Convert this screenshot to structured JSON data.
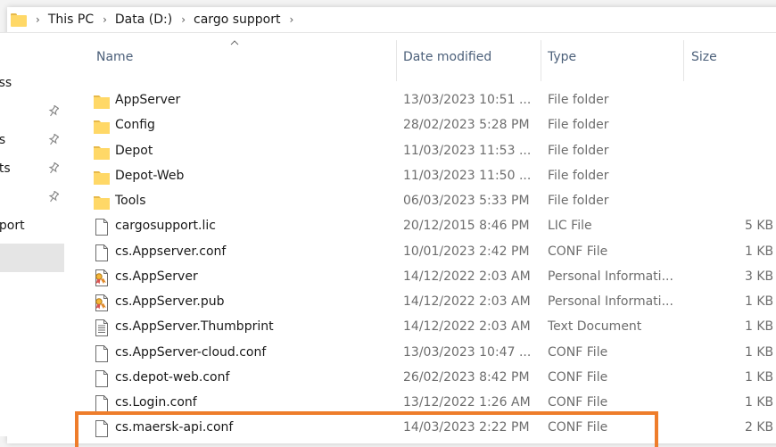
{
  "breadcrumb": [
    "This PC",
    "Data (D:)",
    "cargo support"
  ],
  "nav": {
    "items": [
      {
        "label": "ess",
        "pinned": false
      },
      {
        "label": "",
        "pinned": true
      },
      {
        "label": "ds",
        "pinned": true
      },
      {
        "label": "nts",
        "pinned": true
      },
      {
        "label": "",
        "pinned": true
      },
      {
        "label": "pport",
        "pinned": false
      }
    ]
  },
  "columns": {
    "name": "Name",
    "date": "Date modified",
    "type": "Type",
    "size": "Size"
  },
  "files": [
    {
      "icon": "folder-icon",
      "name": "AppServer",
      "date": "13/03/2023 10:51 ...",
      "type": "File folder",
      "size": ""
    },
    {
      "icon": "folder-icon",
      "name": "Config",
      "date": "28/02/2023 5:28 PM",
      "type": "File folder",
      "size": ""
    },
    {
      "icon": "folder-icon",
      "name": "Depot",
      "date": "11/03/2023 11:53 ...",
      "type": "File folder",
      "size": ""
    },
    {
      "icon": "folder-icon",
      "name": "Depot-Web",
      "date": "11/03/2023 11:50 ...",
      "type": "File folder",
      "size": ""
    },
    {
      "icon": "folder-icon",
      "name": "Tools",
      "date": "06/03/2023 5:33 PM",
      "type": "File folder",
      "size": ""
    },
    {
      "icon": "file-icon",
      "name": "cargosupport.lic",
      "date": "20/12/2015 8:46 PM",
      "type": "LIC File",
      "size": "5 KB"
    },
    {
      "icon": "file-icon",
      "name": "cs.Appserver.conf",
      "date": "10/01/2023 2:42 PM",
      "type": "CONF File",
      "size": "1 KB"
    },
    {
      "icon": "certificate-file-icon",
      "name": "cs.AppServer",
      "date": "14/12/2022 2:03 AM",
      "type": "Personal Informati...",
      "size": "3 KB"
    },
    {
      "icon": "certificate-file-icon",
      "name": "cs.AppServer.pub",
      "date": "14/12/2022 2:03 AM",
      "type": "Personal Informati...",
      "size": "1 KB"
    },
    {
      "icon": "text-file-icon",
      "name": "cs.AppServer.Thumbprint",
      "date": "14/12/2022 2:03 AM",
      "type": "Text Document",
      "size": "1 KB"
    },
    {
      "icon": "file-icon",
      "name": "cs.AppServer-cloud.conf",
      "date": "13/03/2023 10:47 ...",
      "type": "CONF File",
      "size": "1 KB"
    },
    {
      "icon": "file-icon",
      "name": "cs.depot-web.conf",
      "date": "26/02/2023 8:42 PM",
      "type": "CONF File",
      "size": "1 KB"
    },
    {
      "icon": "file-icon",
      "name": "cs.Login.conf",
      "date": "13/12/2022 1:26 AM",
      "type": "CONF File",
      "size": "1 KB"
    },
    {
      "icon": "file-icon",
      "name": "cs.maersk-api.conf",
      "date": "14/03/2023 2:22 PM",
      "type": "CONF File",
      "size": "2 KB"
    }
  ],
  "colors": {
    "highlight": "#ee7d2b",
    "folder": "#ffd867",
    "header_text": "#4c607a"
  }
}
